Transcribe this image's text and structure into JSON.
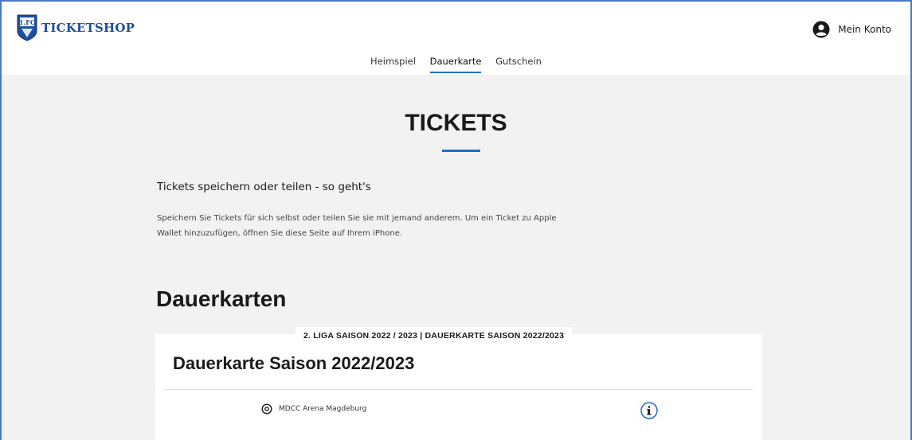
{
  "header": {
    "brand": "TICKETSHOP",
    "logo_label": "1.FC",
    "account_label": "Mein Konto"
  },
  "nav": {
    "items": [
      {
        "label": "Heimspiel",
        "active": false
      },
      {
        "label": "Dauerkarte",
        "active": true
      },
      {
        "label": "Gutschein",
        "active": false
      }
    ]
  },
  "main": {
    "title": "TICKETS",
    "info_heading": "Tickets speichern oder teilen - so geht's",
    "info_text": "Speichern Sie Tickets für sich selbst oder teilen Sie sie mit jemand anderem. Um ein Ticket zu Apple Wallet hinzuzufügen, öffnen Sie diese Seite auf Ihrem iPhone.",
    "section_title": "Dauerkarten"
  },
  "card": {
    "tag": "2. LIGA SAISON 2022 / 2023 | DAUERKARTE SAISON 2022/2023",
    "title": "Dauerkarte Saison 2022/2023",
    "venue": "MDCC Arena Magdeburg",
    "venue_icon": "location-pin-icon",
    "info_icon": "info-icon"
  },
  "colors": {
    "accent": "#1f6fc5",
    "brand": "#1d4f9c",
    "background": "#f2f2f2"
  }
}
